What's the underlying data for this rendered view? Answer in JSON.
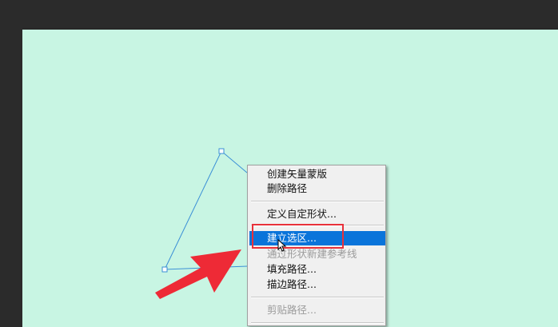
{
  "context_menu": {
    "items": [
      {
        "label": "创建矢量蒙版",
        "enabled": true
      },
      {
        "label": "删除路径",
        "enabled": true
      },
      {
        "label": "定义自定形状...",
        "enabled": true
      },
      {
        "label": "建立选区...",
        "enabled": true,
        "highlighted": true
      },
      {
        "label": "通过形状新建参考线",
        "enabled": false
      },
      {
        "label": "填充路径...",
        "enabled": true
      },
      {
        "label": "描边路径...",
        "enabled": true
      },
      {
        "label": "剪贴路径...",
        "enabled": false
      }
    ]
  },
  "colors": {
    "canvas": "#c8f5e3",
    "workspace": "#2b2b2b",
    "path_stroke": "#3a8fd6",
    "menu_highlight": "#0a74da",
    "annotation_red": "#e8303a"
  },
  "annotations": {
    "box_target": "建立选区...",
    "arrow": "red-pointer-arrow"
  }
}
